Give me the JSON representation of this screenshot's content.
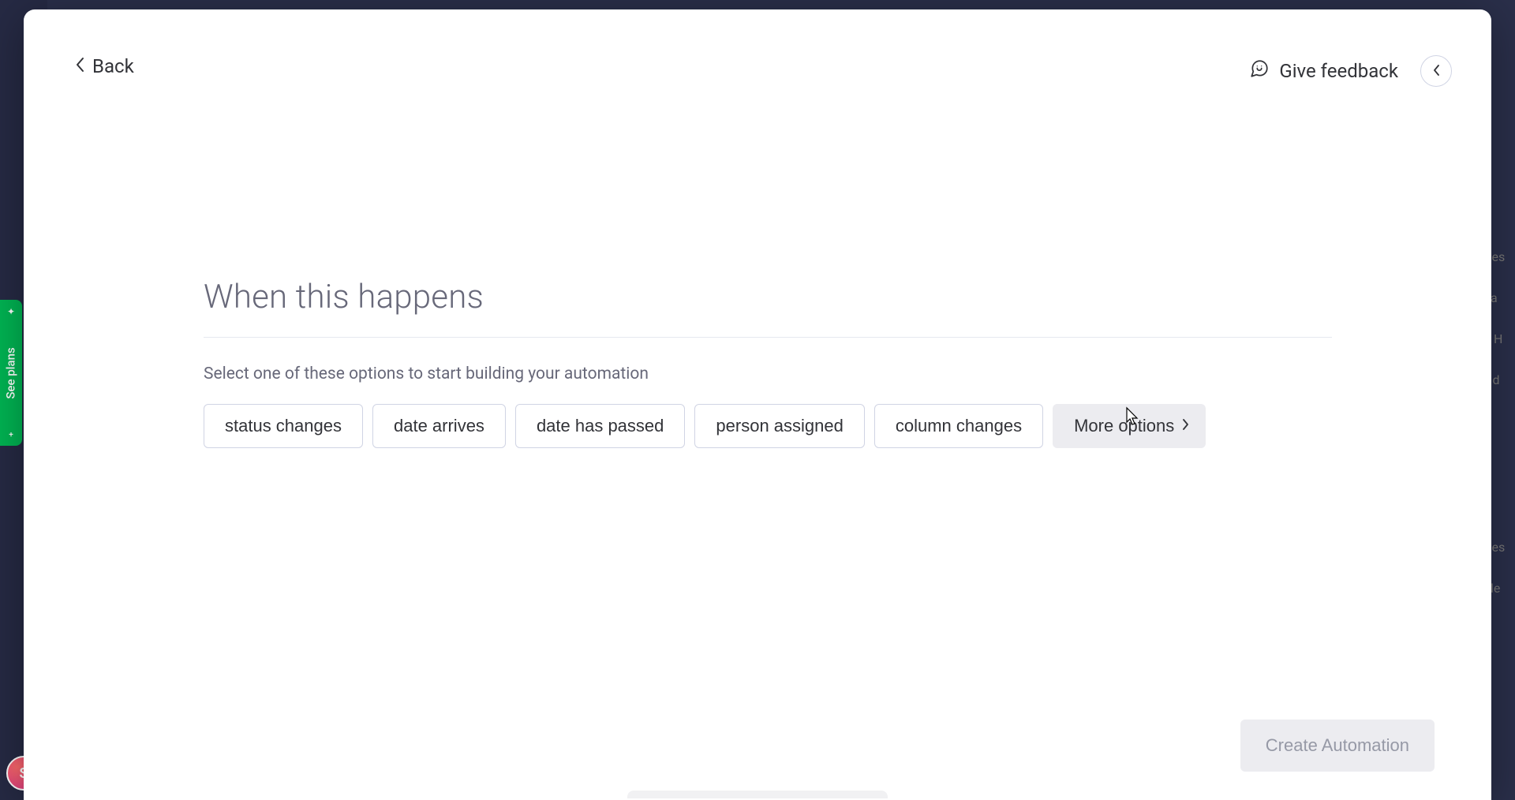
{
  "background": {
    "see_plans_label": "See plans",
    "avatar_initial": "S",
    "right_strip_rows": [
      "Des",
      "ba",
      "d H",
      "y d",
      "Des",
      "ble"
    ]
  },
  "modal": {
    "back_label": "Back",
    "feedback_label": "Give feedback",
    "section_title": "When this happens",
    "helper_text": "Select one of these options to start building your automation",
    "options": {
      "status_changes": "status changes",
      "date_arrives": "date arrives",
      "date_has_passed": "date has passed",
      "person_assigned": "person assigned",
      "column_changes": "column changes",
      "more_options": "More options"
    },
    "create_button": "Create Automation"
  }
}
